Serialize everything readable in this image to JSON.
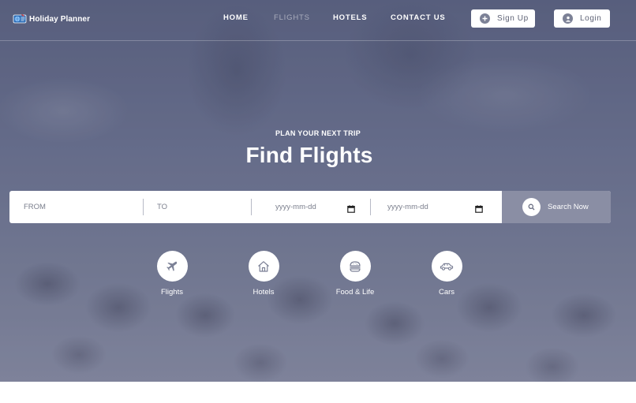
{
  "brand": {
    "name": "Holiday Planner",
    "logo_icon": "globe-ticket-logo"
  },
  "nav": {
    "links": [
      {
        "label": "HOME",
        "active": false
      },
      {
        "label": "FLIGHTS",
        "active": true
      },
      {
        "label": "HOTELS",
        "active": false
      },
      {
        "label": "CONTACT US",
        "active": false
      }
    ],
    "signup_label": "Sign Up",
    "signup_icon": "plus-circle-icon",
    "login_label": "Login",
    "login_icon": "user-icon"
  },
  "hero": {
    "eyebrow": "PLAN YOUR NEXT TRIP",
    "title": "Find Flights"
  },
  "search": {
    "from_placeholder": "FROM",
    "to_placeholder": "TO",
    "depart_date": "yyyy-mm-dd",
    "return_date": "yyyy-mm-dd",
    "button_label": "Search Now"
  },
  "categories": [
    {
      "label": "Flights",
      "icon": "plane-icon"
    },
    {
      "label": "Hotels",
      "icon": "home-icon"
    },
    {
      "label": "Food & Life",
      "icon": "burger-icon"
    },
    {
      "label": "Cars",
      "icon": "car-icon"
    }
  ],
  "colors": {
    "accent": "#8a8ea4",
    "nav_active": "#a9adbd",
    "text_on_hero": "#ffffff"
  }
}
